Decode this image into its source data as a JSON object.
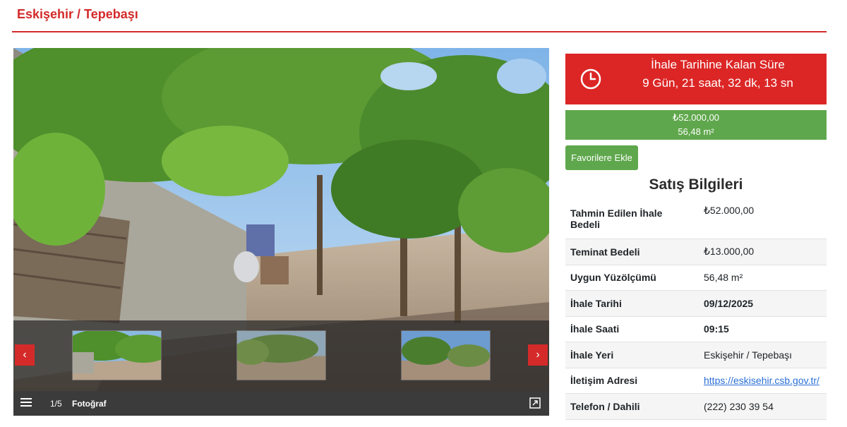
{
  "header": {
    "location": "Eskişehir / Tepebaşı"
  },
  "gallery": {
    "counter": "1/5",
    "label": "Fotoğraf",
    "prev_icon": "‹",
    "next_icon": "›",
    "icons": [
      "menu-icon",
      "fullscreen-icon",
      "chevron-left-icon",
      "chevron-right-icon"
    ]
  },
  "countdown": {
    "title": "İhale Tarihine Kalan Süre",
    "value": "9 Gün, 21 saat, 32 dk, 13 sn",
    "icon": "clock-icon"
  },
  "summary": {
    "price": "₺52.000,00",
    "area": "56,48 m²"
  },
  "favorite_button": "Favorilere Ekle",
  "sales": {
    "heading": "Satış Bilgileri",
    "rows": [
      {
        "label": "Tahmin Edilen İhale Bedeli",
        "value": "₺52.000,00"
      },
      {
        "label": "Teminat Bedeli",
        "value": "₺13.000,00"
      },
      {
        "label": "Uygun Yüzölçümü",
        "value": "56,48 m²"
      },
      {
        "label": "İhale Tarihi",
        "value": "09/12/2025"
      },
      {
        "label": "İhale Saati",
        "value": "09:15"
      },
      {
        "label": "İhale Yeri",
        "value": "Eskişehir / Tepebaşı"
      },
      {
        "label": "İletişim Adresi",
        "value": "https://eskisehir.csb.gov.tr/"
      },
      {
        "label": "Telefon / Dahili",
        "value": "(222) 230 39 54"
      }
    ]
  },
  "colors": {
    "accent_red": "#dc2626",
    "accent_green": "#5fa74c",
    "link": "#2a6fd6"
  }
}
